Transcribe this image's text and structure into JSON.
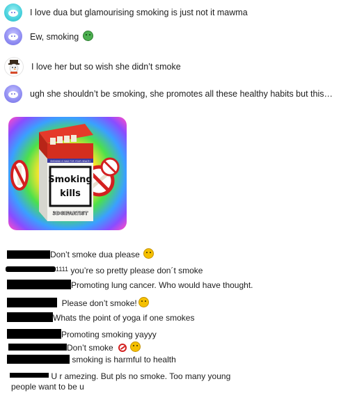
{
  "comments": [
    {
      "text": "I love dua but glamourising smoking is just not it mawma",
      "avatar": "teal-snoo-avatar"
    },
    {
      "text": "Ew, smoking",
      "emoji": "nauseated-face-emoji",
      "avatar": "purple-snoo-avatar"
    },
    {
      "text": "I love her but so wish she didn’t smoke",
      "avatar": "snowman-hat-avatar"
    },
    {
      "text": "ugh she shouldn’t be smoking, she promotes all these healthy habits but this…",
      "avatar": "purple-snoo-avatar"
    }
  ],
  "gif": {
    "pack_label_line1": "Smoking",
    "pack_label_line2": "kills",
    "watermark": "3DGIFARTIST",
    "pack_header": "SMOKING IS BAD FOR YOUR HEALTH"
  },
  "list": [
    {
      "text": "Don’t smoke dua please",
      "emoji": "astonished-face-emoji"
    },
    {
      "prefix": "1111",
      "text": "you’re so pretty please don´t smoke"
    },
    {
      "text": "Promoting lung cancer. Who would have thought."
    },
    {
      "text": "Please don’t smoke!",
      "emoji": "sad-face-emoji"
    },
    {
      "text": "Whats the point of yoga if one smokes"
    },
    {
      "text": "Promoting smoking yayyy"
    },
    {
      "text": "Don’t smoke",
      "emoji": "no-smoking-emoji",
      "emoji2": "sad-face-emoji"
    },
    {
      "text": "smoking is harmful to health"
    },
    {
      "text": "U r amezing. But pls no smoke. Too many young",
      "text2": "people want to be u"
    }
  ],
  "colors": {
    "no_smoking_red": "#d32020",
    "redaction": "#000000"
  }
}
